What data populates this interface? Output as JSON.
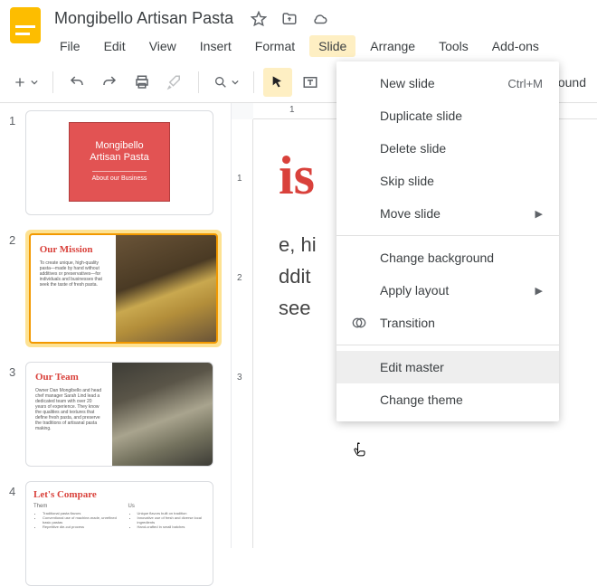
{
  "doc": {
    "title": "Mongibello Artisan Pasta"
  },
  "menubar": {
    "file": "File",
    "edit": "Edit",
    "view": "View",
    "insert": "Insert",
    "format": "Format",
    "slide": "Slide",
    "arrange": "Arrange",
    "tools": "Tools",
    "addons": "Add-ons"
  },
  "toolbar": {
    "background_peek": "ckground"
  },
  "ruler_h": {
    "t1": "1"
  },
  "ruler_v": {
    "t1": "1",
    "t2": "2",
    "t3": "3"
  },
  "thumbs": {
    "n1": "1",
    "n2": "2",
    "n3": "3",
    "n4": "4"
  },
  "slide1": {
    "line1": "Mongibello",
    "line2": "Artisan Pasta",
    "sub": "About our Business"
  },
  "slide2": {
    "title": "Our Mission",
    "body": "To create unique, high-quality pasta—made by hand without additives or preservatives—for individuals and businesses that seek the taste of fresh pasta."
  },
  "slide3": {
    "title": "Our Team",
    "body": "Owner Dan Mongibello and head chef manager Sarah Lind lead a dedicated team with over 20 years of experience. They know the qualities and textures that define fresh pasta, and preserve the traditions of artisanal pasta making."
  },
  "slide4": {
    "title": "Let's Compare",
    "hdr1": "Them",
    "hdr2": "Us",
    "c1a": "Traditional pasta flavors",
    "c1b": "Conventional use of machine-made, unrefined basic pastas",
    "c1c": "Repetitive die-cut process",
    "c2a": "Unique flavors built on tradition",
    "c2b": "Innovative use of fresh and diverse local ingredients",
    "c2c": "Hand-crafted in small batches"
  },
  "canvas": {
    "title_fragment": "is",
    "l1": "e, hi",
    "l2": "ddit",
    "l3": " see"
  },
  "dropdown": {
    "new_slide": "New slide",
    "new_slide_sc": "Ctrl+M",
    "duplicate": "Duplicate slide",
    "delete": "Delete slide",
    "skip": "Skip slide",
    "move": "Move slide",
    "change_bg": "Change background",
    "apply_layout": "Apply layout",
    "transition": "Transition",
    "edit_master": "Edit master",
    "change_theme": "Change theme"
  }
}
